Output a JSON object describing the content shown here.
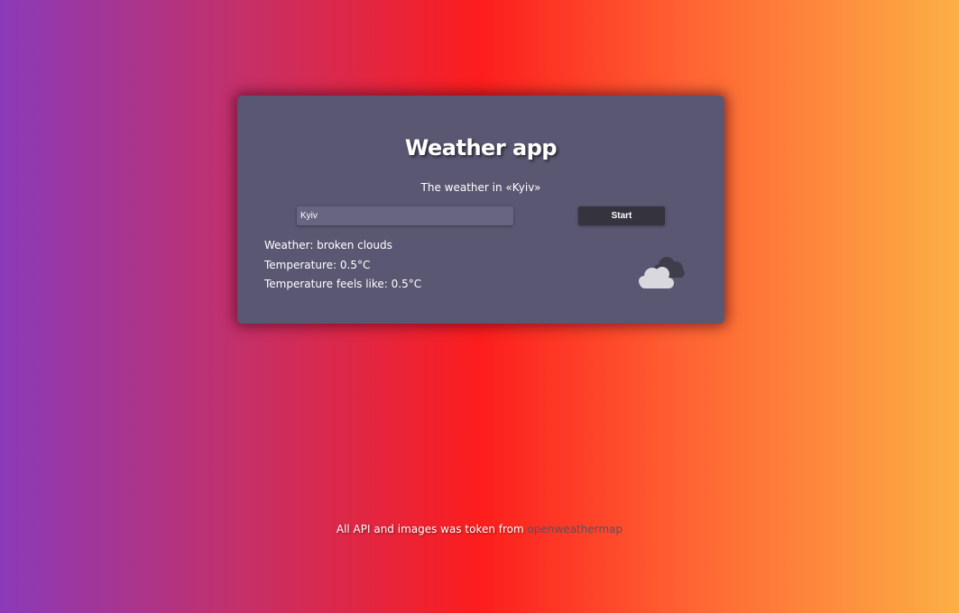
{
  "app": {
    "title": "Weather app",
    "subtitle": "The weather in «Kyiv»"
  },
  "search": {
    "value": "Kyiv",
    "placeholder": "",
    "button_label": "Start"
  },
  "weather": {
    "description": "Weather: broken clouds",
    "temperature": "Temperature: 0.5°C",
    "feels_like": "Temperature feels like: 0.5°C",
    "icon": "broken-clouds-icon"
  },
  "footer": {
    "text": "All API and images was token from",
    "link_text": "openweathermap"
  },
  "colors": {
    "card_bg": "#5a5772",
    "button_bg": "#34333e",
    "input_bg": "#676582",
    "link": "#555160"
  }
}
